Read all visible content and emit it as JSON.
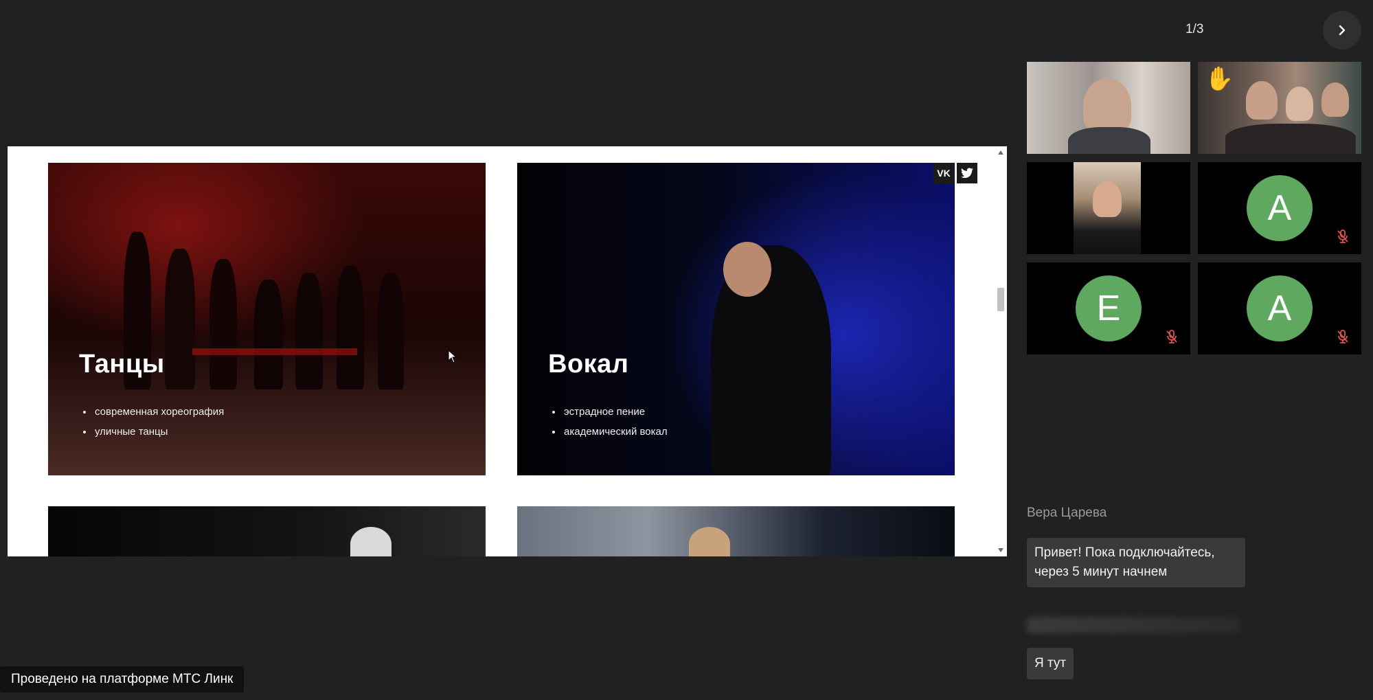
{
  "share": {
    "cards": [
      {
        "title": "Танцы",
        "items": [
          "современная хореография",
          "уличные танцы"
        ]
      },
      {
        "title": "Вокал",
        "items": [
          "эстрадное пение",
          "академический вокал"
        ]
      }
    ],
    "social": {
      "vk_label": "VK",
      "twitter_label": "🐦"
    }
  },
  "participants": {
    "pager": "1/3",
    "tiles": [
      {
        "type": "video"
      },
      {
        "type": "video",
        "hand_raised": true,
        "hand_icon": "✋"
      },
      {
        "type": "video"
      },
      {
        "type": "avatar",
        "initial": "А",
        "muted": true,
        "avatar_color": "#5fa860"
      },
      {
        "type": "avatar",
        "initial": "Е",
        "muted": true,
        "avatar_color": "#5fa860"
      },
      {
        "type": "avatar",
        "initial": "А",
        "muted": true,
        "avatar_color": "#5fa860"
      }
    ]
  },
  "chat": {
    "sender": "Вера Царева",
    "message_1": "Привет! Пока подключайтесь, через 5 минут начнем",
    "message_2": "Я тут"
  },
  "footer": {
    "platform_label": "Проведено на платформе МТС Линк"
  },
  "colors": {
    "background": "#212121",
    "avatar": "#5fa860",
    "muted_icon": "#e05252"
  }
}
